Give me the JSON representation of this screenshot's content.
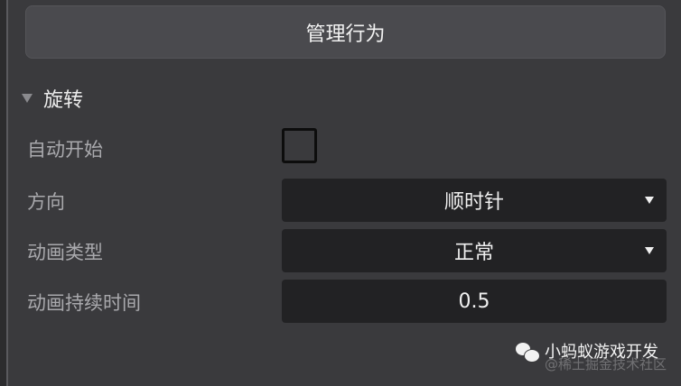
{
  "manage_button": {
    "label": "管理行为"
  },
  "section": {
    "title": "旋转",
    "expanded": true
  },
  "properties": {
    "auto_start": {
      "label": "自动开始",
      "checked": false
    },
    "direction": {
      "label": "方向",
      "value": "顺时针"
    },
    "animation_type": {
      "label": "动画类型",
      "value": "正常"
    },
    "animation_duration": {
      "label": "动画持续时间",
      "value": "0.5"
    }
  },
  "watermark": {
    "main": "小蚂蚁游戏开发",
    "sub": "@稀土掘金技术社区"
  },
  "colors": {
    "background": "#3a3a3d",
    "field_background": "#222224",
    "label_text": "#a9a9ad",
    "button_background": "#4a4a4e"
  }
}
